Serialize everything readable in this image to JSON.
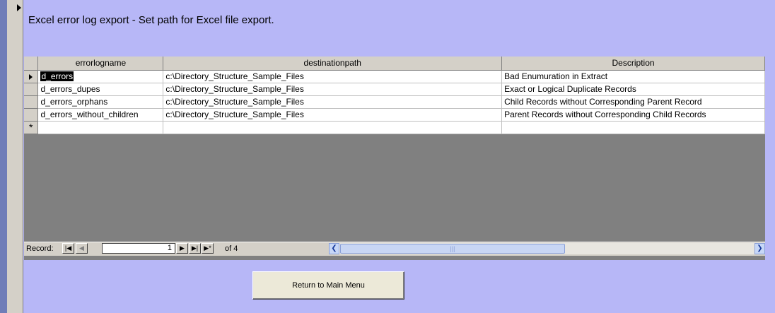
{
  "form": {
    "title": "Excel error log export - Set path for Excel file export."
  },
  "datasheet": {
    "columns": [
      "errorlogname",
      "destinationpath",
      "Description"
    ],
    "rows": [
      [
        "d_errors",
        "c:\\Directory_Structure_Sample_Files",
        "Bad Enumuration in Extract"
      ],
      [
        "d_errors_dupes",
        "c:\\Directory_Structure_Sample_Files",
        "Exact or Logical Duplicate Records"
      ],
      [
        "d_errors_orphans",
        "c:\\Directory_Structure_Sample_Files",
        "Child Records without Corresponding Parent Record"
      ],
      [
        "d_errors_without_children",
        "c:\\Directory_Structure_Sample_Files",
        "Parent Records without Corresponding Child Records"
      ]
    ],
    "current_row_index": 0,
    "new_record_marker": "*"
  },
  "navigation": {
    "record_label": "Record:",
    "current_record": "1",
    "of_label": "of 4",
    "first_icon": "first-record-icon",
    "prev_icon": "previous-record-icon",
    "next_icon": "next-record-icon",
    "last_icon": "last-record-icon",
    "new_icon": "new-record-icon"
  },
  "actions": {
    "return_label": "Return to Main Menu"
  },
  "colors": {
    "form_background": "#b7b7f7",
    "datasheet_background": "#808080",
    "frame_blue": "#6f7db8"
  }
}
